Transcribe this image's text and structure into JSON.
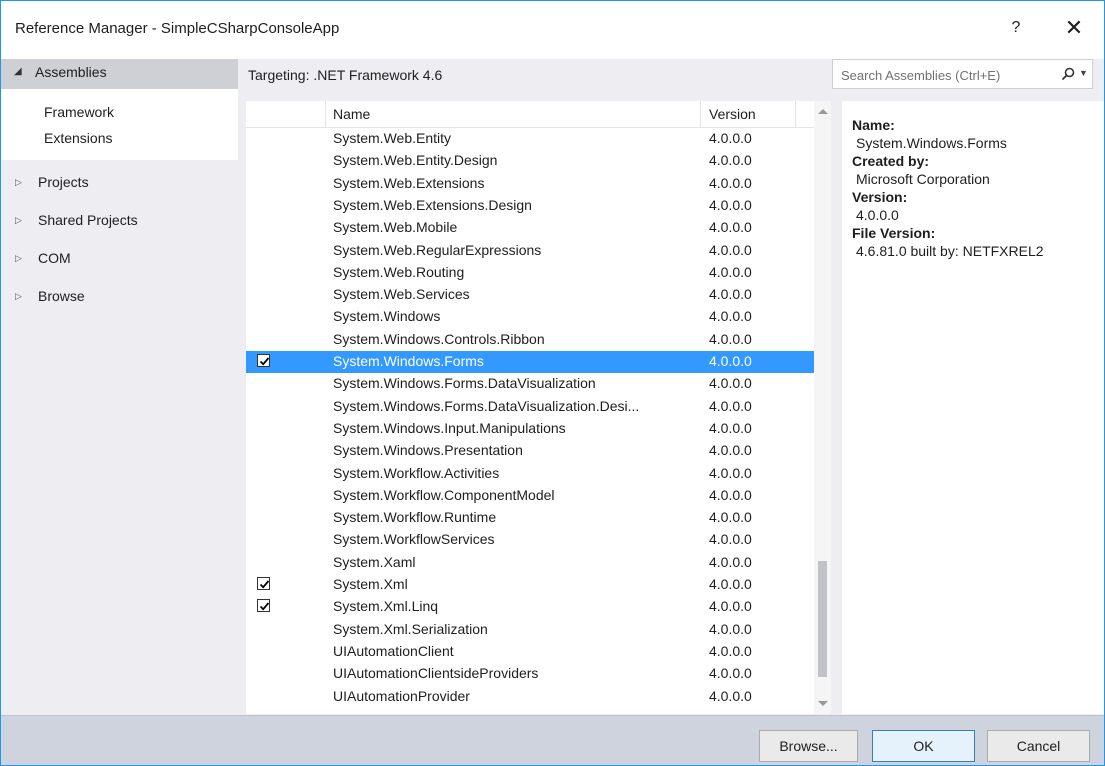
{
  "window": {
    "title": "Reference Manager - SimpleCSharpConsoleApp",
    "help": "?",
    "close": "✕"
  },
  "sidebar": {
    "header": "Assemblies",
    "subitems": [
      "Framework",
      "Extensions"
    ],
    "items": [
      "Projects",
      "Shared Projects",
      "COM",
      "Browse"
    ]
  },
  "main": {
    "targeting": "Targeting: .NET Framework 4.6",
    "search_placeholder": "Search Assemblies (Ctrl+E)",
    "columns": {
      "name": "Name",
      "version": "Version"
    },
    "rows": [
      {
        "name": "System.Web.Entity",
        "version": "4.0.0.0",
        "checked": false,
        "selected": false
      },
      {
        "name": "System.Web.Entity.Design",
        "version": "4.0.0.0",
        "checked": false,
        "selected": false
      },
      {
        "name": "System.Web.Extensions",
        "version": "4.0.0.0",
        "checked": false,
        "selected": false
      },
      {
        "name": "System.Web.Extensions.Design",
        "version": "4.0.0.0",
        "checked": false,
        "selected": false
      },
      {
        "name": "System.Web.Mobile",
        "version": "4.0.0.0",
        "checked": false,
        "selected": false
      },
      {
        "name": "System.Web.RegularExpressions",
        "version": "4.0.0.0",
        "checked": false,
        "selected": false
      },
      {
        "name": "System.Web.Routing",
        "version": "4.0.0.0",
        "checked": false,
        "selected": false
      },
      {
        "name": "System.Web.Services",
        "version": "4.0.0.0",
        "checked": false,
        "selected": false
      },
      {
        "name": "System.Windows",
        "version": "4.0.0.0",
        "checked": false,
        "selected": false
      },
      {
        "name": "System.Windows.Controls.Ribbon",
        "version": "4.0.0.0",
        "checked": false,
        "selected": false
      },
      {
        "name": "System.Windows.Forms",
        "version": "4.0.0.0",
        "checked": true,
        "selected": true
      },
      {
        "name": "System.Windows.Forms.DataVisualization",
        "version": "4.0.0.0",
        "checked": false,
        "selected": false
      },
      {
        "name": "System.Windows.Forms.DataVisualization.Desi...",
        "version": "4.0.0.0",
        "checked": false,
        "selected": false
      },
      {
        "name": "System.Windows.Input.Manipulations",
        "version": "4.0.0.0",
        "checked": false,
        "selected": false
      },
      {
        "name": "System.Windows.Presentation",
        "version": "4.0.0.0",
        "checked": false,
        "selected": false
      },
      {
        "name": "System.Workflow.Activities",
        "version": "4.0.0.0",
        "checked": false,
        "selected": false
      },
      {
        "name": "System.Workflow.ComponentModel",
        "version": "4.0.0.0",
        "checked": false,
        "selected": false
      },
      {
        "name": "System.Workflow.Runtime",
        "version": "4.0.0.0",
        "checked": false,
        "selected": false
      },
      {
        "name": "System.WorkflowServices",
        "version": "4.0.0.0",
        "checked": false,
        "selected": false
      },
      {
        "name": "System.Xaml",
        "version": "4.0.0.0",
        "checked": false,
        "selected": false
      },
      {
        "name": "System.Xml",
        "version": "4.0.0.0",
        "checked": true,
        "selected": false
      },
      {
        "name": "System.Xml.Linq",
        "version": "4.0.0.0",
        "checked": true,
        "selected": false
      },
      {
        "name": "System.Xml.Serialization",
        "version": "4.0.0.0",
        "checked": false,
        "selected": false
      },
      {
        "name": "UIAutomationClient",
        "version": "4.0.0.0",
        "checked": false,
        "selected": false
      },
      {
        "name": "UIAutomationClientsideProviders",
        "version": "4.0.0.0",
        "checked": false,
        "selected": false
      },
      {
        "name": "UIAutomationProvider",
        "version": "4.0.0.0",
        "checked": false,
        "selected": false
      }
    ]
  },
  "details": {
    "name_label": "Name:",
    "name_value": "System.Windows.Forms",
    "created_label": "Created by:",
    "created_value": "Microsoft Corporation",
    "version_label": "Version:",
    "version_value": "4.0.0.0",
    "file_version_label": "File Version:",
    "file_version_value": "4.6.81.0 built by: NETFXREL2"
  },
  "buttons": {
    "browse": "Browse...",
    "ok": "OK",
    "cancel": "Cancel"
  },
  "colors": {
    "selection": "#3399ff",
    "border_accent": "#1c97ea",
    "footer": "#cfd3dd"
  }
}
